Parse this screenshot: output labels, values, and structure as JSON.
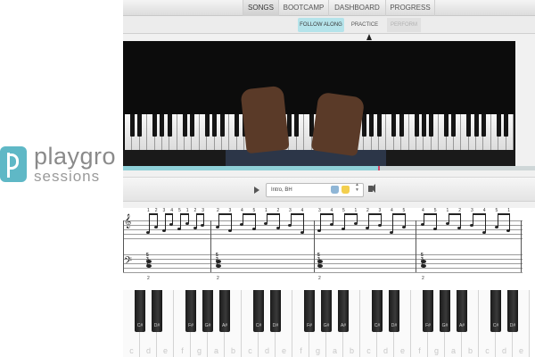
{
  "logo": {
    "word": "playgro",
    "sub": "sessions"
  },
  "nav": {
    "tabs": [
      {
        "label": "SONGS",
        "active": true
      },
      {
        "label": "BOOTCAMP",
        "active": false
      },
      {
        "label": "DASHBOARD",
        "active": false
      },
      {
        "label": "PROGRESS",
        "active": false
      }
    ]
  },
  "subnav": {
    "tabs": [
      {
        "label": "FOLLOW ALONG",
        "state": "active"
      },
      {
        "label": "PRACTICE",
        "state": "normal"
      },
      {
        "label": "PERFORM",
        "state": "disabled"
      }
    ]
  },
  "player": {
    "progress_fraction": 0.62,
    "marker_fraction": 0.6
  },
  "controls": {
    "section_value": "Intro, BH",
    "icons": [
      "play-icon",
      "left-hand-icon",
      "right-hand-icon",
      "select-arrows-icon",
      "volume-icon"
    ],
    "left_hand_color": "#8fb6d6",
    "right_hand_color": "#f3cf4e"
  },
  "sheet": {
    "chords": [
      {
        "top": "5",
        "mid": "3",
        "bot": "1"
      },
      {
        "top": "5",
        "mid": "2",
        "bot": "1"
      },
      {
        "top": "5",
        "mid": "3",
        "bot": "1"
      },
      {
        "top": "5",
        "mid": "3",
        "bot": "1"
      }
    ],
    "lh_fingers": [
      "2",
      "2",
      "2",
      "2"
    ]
  },
  "keyboard": {
    "white_labels": [
      "c",
      "d",
      "e",
      "f",
      "g",
      "a",
      "b",
      "c",
      "d",
      "e",
      "f",
      "g",
      "a",
      "b",
      "c",
      "d",
      "e",
      "f",
      "g",
      "a",
      "b",
      "c",
      "d",
      "e"
    ],
    "black_labels": [
      "C#",
      "D#",
      "F#",
      "G#",
      "A#",
      "C#",
      "D#",
      "F#",
      "G#",
      "A#",
      "C#",
      "D#",
      "F#",
      "G#",
      "A#",
      "C#",
      "D#"
    ]
  },
  "colors": {
    "accent": "#b5e3ea",
    "brand": "#5fb8c6",
    "progress": "#8fd0d8",
    "marker": "#d14a6a"
  }
}
